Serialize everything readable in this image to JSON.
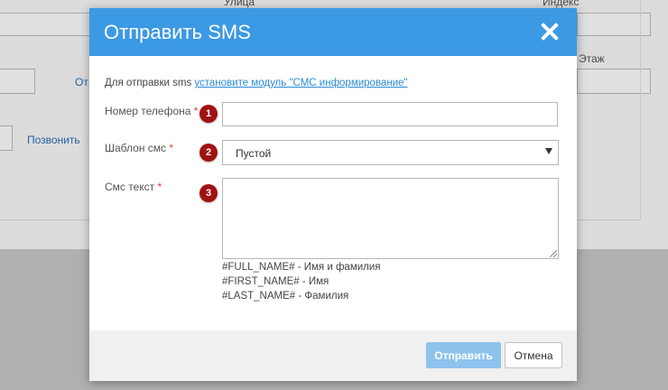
{
  "background": {
    "label_street": "Улица",
    "label_index": "Индекс",
    "label_floor": "Этаж",
    "link_partial": "От",
    "link_call": "Позвонить"
  },
  "modal": {
    "title": "Отправить SMS",
    "info_prefix": "Для отправки sms ",
    "info_link": "установите модуль \"СМС информирование\"",
    "fields": {
      "phone": {
        "label": "Номер телефона ",
        "required_mark": "*",
        "badge": "1",
        "value": ""
      },
      "template": {
        "label": "Шаблон смс ",
        "required_mark": "*",
        "badge": "2",
        "selected": "Пустой"
      },
      "text": {
        "label": "Смс текст ",
        "required_mark": "*",
        "badge": "3",
        "value": ""
      }
    },
    "hints": [
      "#FULL_NAME# - Имя и фамилия",
      "#FIRST_NAME# - Имя",
      "#LAST_NAME# - Фамилия"
    ],
    "buttons": {
      "send": "Отправить",
      "cancel": "Отмена"
    }
  },
  "colors": {
    "header": "#3c99e3",
    "badge": "#a11212",
    "send_button": "#8ec3ee",
    "link": "#2a8bd6"
  }
}
